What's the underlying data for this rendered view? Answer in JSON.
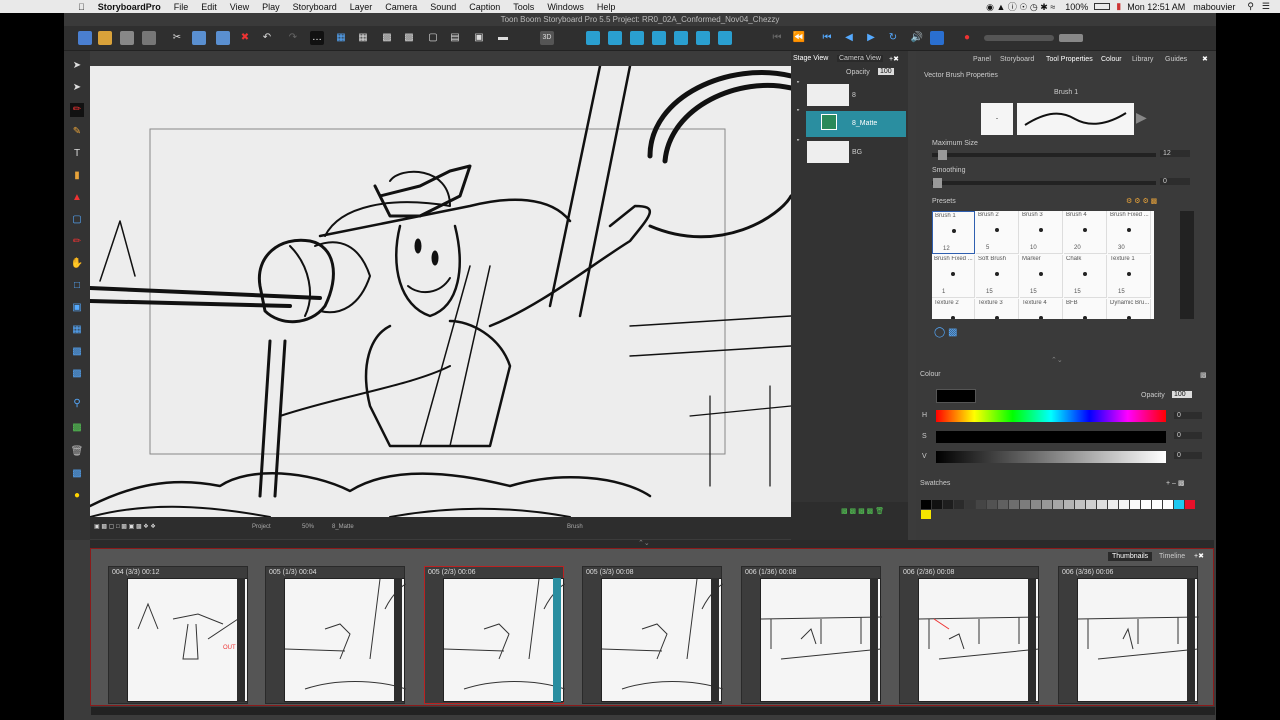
{
  "macbar": {
    "app_name": "StoryboardPro",
    "menus": [
      "File",
      "Edit",
      "View",
      "Play",
      "Storyboard",
      "Layer",
      "Camera",
      "Sound",
      "Caption",
      "Tools",
      "Windows",
      "Help"
    ],
    "battery": "100%",
    "clock": "Mon 12:51 AM",
    "user": "mabouvier"
  },
  "window": {
    "title": "Toon Boom Storyboard Pro 5.5 Project: RR0_02A_Conformed_Nov04_Chezzy"
  },
  "stage_panel": {
    "bottom_labels": {
      "project": "Project",
      "zoom": "50%",
      "layer": "8_Matte",
      "tool": "Brush"
    }
  },
  "stage_view_panel": {
    "tabs": [
      "Stage View",
      "Camera View"
    ],
    "opacity_label": "Opacity",
    "opacity_value": "100",
    "layers": [
      {
        "name": "8"
      },
      {
        "name": "8_Matte"
      },
      {
        "name": "BG"
      }
    ]
  },
  "tool_panel": {
    "tabs": [
      "Panel",
      "Storyboard",
      "Tool Properties",
      "Colour",
      "Library",
      "Guides"
    ],
    "section_title": "Vector Brush Properties",
    "brush_name": "Brush 1",
    "max_size_label": "Maximum Size",
    "max_size_value": "12",
    "smoothing_label": "Smoothing",
    "smoothing_value": "0",
    "presets_label": "Presets",
    "presets": [
      {
        "name": "Brush 1",
        "size": "12"
      },
      {
        "name": "Brush 2",
        "size": "5"
      },
      {
        "name": "Brush 3",
        "size": "10"
      },
      {
        "name": "Brush 4",
        "size": "20"
      },
      {
        "name": "Brush Fixed ...",
        "size": "30"
      },
      {
        "name": "Brush Fixed ...",
        "size": "1"
      },
      {
        "name": "Soft Brush",
        "size": "15"
      },
      {
        "name": "Marker",
        "size": "15"
      },
      {
        "name": "Chalk",
        "size": "15"
      },
      {
        "name": "Texture 1",
        "size": "15"
      },
      {
        "name": "Texture 2",
        "size": ""
      },
      {
        "name": "Texture 3",
        "size": ""
      },
      {
        "name": "Texture 4",
        "size": ""
      },
      {
        "name": "BFB",
        "size": ""
      },
      {
        "name": "Dynamic Bru...",
        "size": ""
      }
    ],
    "colour_label": "Colour",
    "colour_opacity_label": "Opacity",
    "colour_opacity_value": "100",
    "h_label": "H",
    "h_value": "0",
    "s_label": "S",
    "s_value": "0",
    "v_label": "V",
    "v_value": "0",
    "swatches_label": "Swatches",
    "current_colour": "#000000"
  },
  "thumbnails_panel": {
    "tabs": [
      "Thumbnails",
      "Timeline"
    ],
    "thumbs": [
      {
        "header": "004 (3/3) 00:12"
      },
      {
        "header": "005 (1/3) 00:04"
      },
      {
        "header": "005 (2/3) 00:06"
      },
      {
        "header": "005 (3/3) 00:08"
      },
      {
        "header": "006 (1/36) 00:08"
      },
      {
        "header": "006 (2/36) 00:08"
      },
      {
        "header": "006 (3/36) 00:06"
      }
    ]
  },
  "colors": {
    "selected_layer": "#2a8ea0",
    "accent_red": "#8a1a1a",
    "selection_blue": "#2f5fb0"
  }
}
